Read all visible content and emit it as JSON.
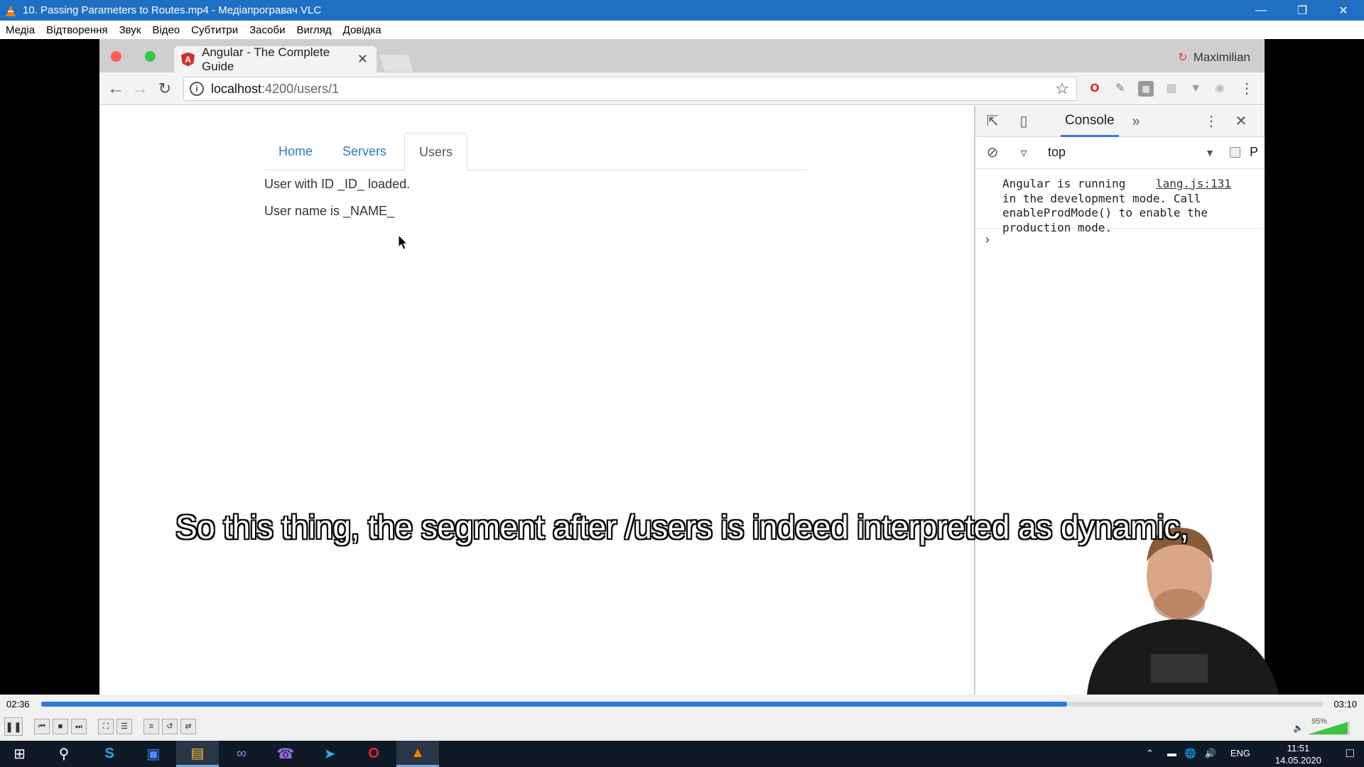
{
  "vlc": {
    "title": "10. Passing Parameters to Routes.mp4 - Медіапрогравач VLC",
    "menu": [
      "Медіа",
      "Відтворення",
      "Звук",
      "Відео",
      "Субтитри",
      "Засоби",
      "Вигляд",
      "Довідка"
    ],
    "elapsed": "02:36",
    "total": "03:10",
    "progress": 0.8,
    "volume_label": "95%",
    "volume": 0.95
  },
  "browser": {
    "tab_title": "Angular - The Complete Guide",
    "profile_name": "Maximilian",
    "url_host": "localhost",
    "url_path": ":4200/users/1"
  },
  "page": {
    "tabs": [
      "Home",
      "Servers",
      "Users"
    ],
    "active_tab": "Users",
    "line1": "User with ID _ID_ loaded.",
    "line2": "User name is _NAME_"
  },
  "devtools": {
    "panel": "Console",
    "context": "top",
    "filter_label": "P",
    "message": "Angular is running\nin the development mode. Call\nenableProdMode() to enable the\nproduction mode.",
    "source_link": "lang.js:131"
  },
  "subtitle": "So this thing, the segment after /users is indeed interpreted as dynamic,",
  "taskbar": {
    "lang": "ENG",
    "time": "11:51",
    "date": "14.05.2020"
  },
  "colors": {
    "vlc_title": "#1f6fc4",
    "link_blue": "#337ab7",
    "progress_blue": "#2a7be0",
    "taskbar": "#101a26"
  }
}
